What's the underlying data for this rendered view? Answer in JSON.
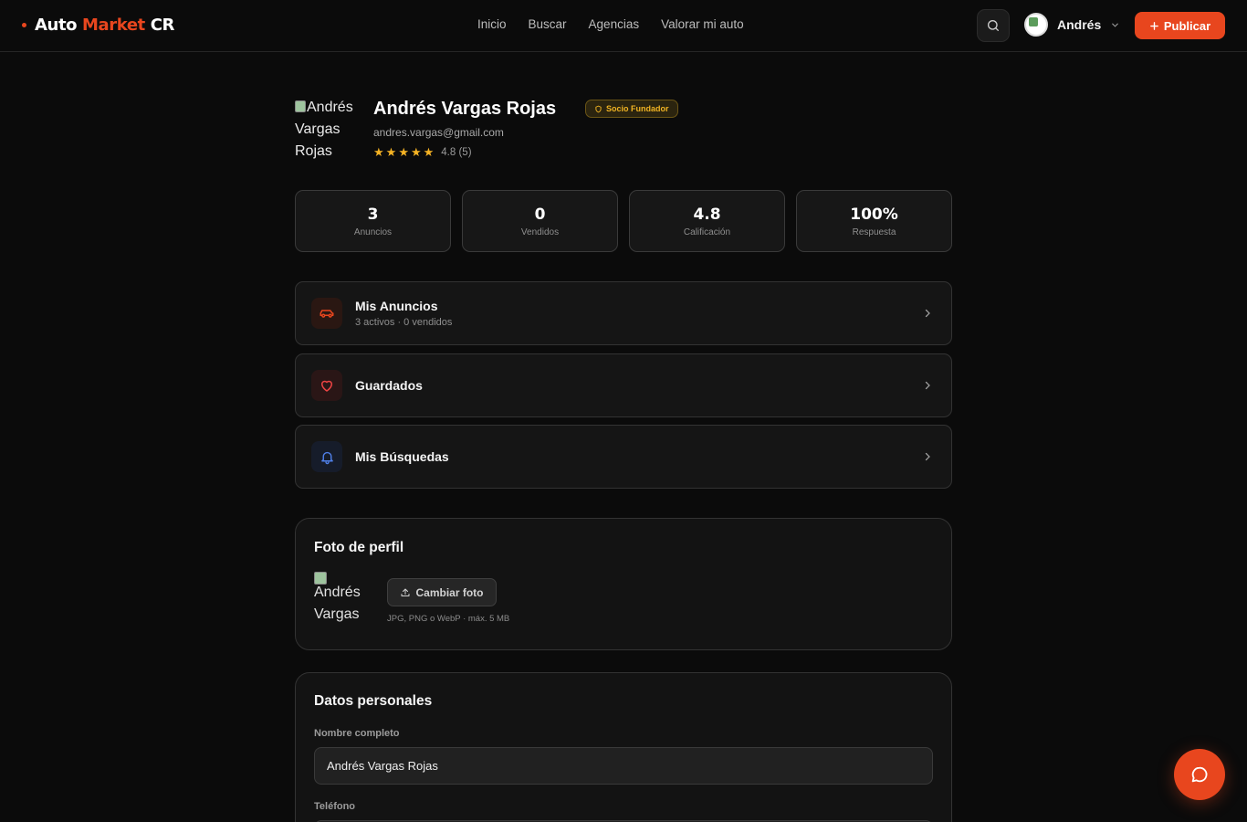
{
  "brand": {
    "name_part1": "Auto",
    "name_part2": "Market",
    "name_part3": "CR",
    "accent_color": "#e8461e"
  },
  "nav": {
    "items": [
      "Inicio",
      "Buscar",
      "Agencias",
      "Valorar mi auto"
    ]
  },
  "header": {
    "search_icon": "search-icon",
    "user_name": "Andrés",
    "publish_label": "Publicar"
  },
  "profile": {
    "avatar_alt": "Andrés Vargas Rojas",
    "name": "Andrés Vargas Rojas",
    "badge": "Socio Fundador",
    "email": "andres.vargas@gmail.com",
    "rating_value": 4.8,
    "rating_text": "4.8 (5)"
  },
  "stats": [
    {
      "value": "3",
      "label": "Anuncios"
    },
    {
      "value": "0",
      "label": "Vendidos"
    },
    {
      "value": "4.8",
      "label": "Calificación"
    },
    {
      "value": "100%",
      "label": "Respuesta"
    }
  ],
  "menu": [
    {
      "title": "Mis Anuncios",
      "subtitle": "3 activos · 0 vendidos",
      "icon": "car-icon"
    },
    {
      "title": "Guardados",
      "subtitle": "",
      "icon": "heart-icon"
    },
    {
      "title": "Mis Búsquedas",
      "subtitle": "",
      "icon": "bell-icon"
    }
  ],
  "photo_section": {
    "title": "Foto de perfil",
    "preview_alt": "Andrés Vargas",
    "change_label": "Cambiar foto",
    "hint": "JPG, PNG o WebP · máx. 5 MB"
  },
  "personal": {
    "title": "Datos personales",
    "name_label": "Nombre completo",
    "name_value": "Andrés Vargas Rojas",
    "phone_label": "Teléfono"
  }
}
